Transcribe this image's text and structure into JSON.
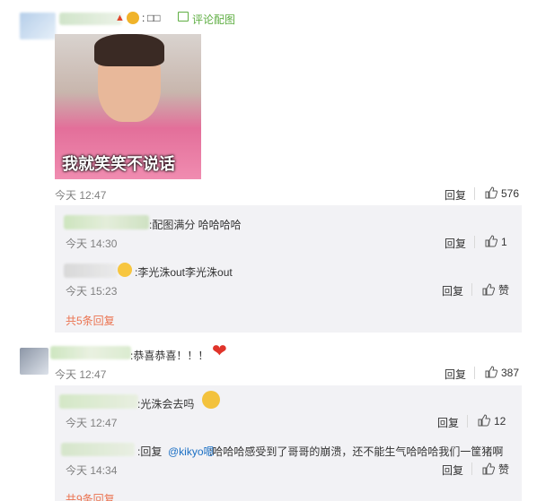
{
  "main_comment": {
    "user_suffix": ":",
    "pic_label": "评论配图",
    "meme_caption": "我就笑笑不说话",
    "time": "今天 12:47",
    "reply_label": "回复",
    "like_count": "576"
  },
  "sub_replies_1": [
    {
      "user": "竞雪...的妳",
      "text": ":配图满分 哈哈哈哈",
      "time": "今天 14:30",
      "reply_label": "回复",
      "like_count": "1"
    },
    {
      "user": "Kathy_Po",
      "text": ":李光洙out李光洙out",
      "time": "今天 15:23",
      "reply_label": "回复",
      "like_label": "赞"
    }
  ],
  "more_replies_1": "共5条回复",
  "second_comment": {
    "user": "...",
    "text": ":恭喜恭喜！！！",
    "time": "今天 12:47",
    "reply_label": "回复",
    "like_count": "387"
  },
  "sub_replies_2": [
    {
      "user": "...",
      "text": ":光洙会去吗",
      "time": "今天 12:47",
      "reply_label": "回复",
      "like_count": "12"
    },
    {
      "user": "...",
      "text_prefix": ":回复",
      "mention": "@kikyo嗯",
      "text": ":哈哈哈感受到了哥哥的崩溃，还不能生气哈哈哈我们一筐猪啊",
      "time": "今天 14:34",
      "reply_label": "回复",
      "like_label": "赞"
    }
  ],
  "more_replies_2": "共9条回复",
  "colors": {
    "link": "#eb7350",
    "mention": "#1a6fc4",
    "reply_bg": "#f2f2f5",
    "time": "#808080"
  }
}
